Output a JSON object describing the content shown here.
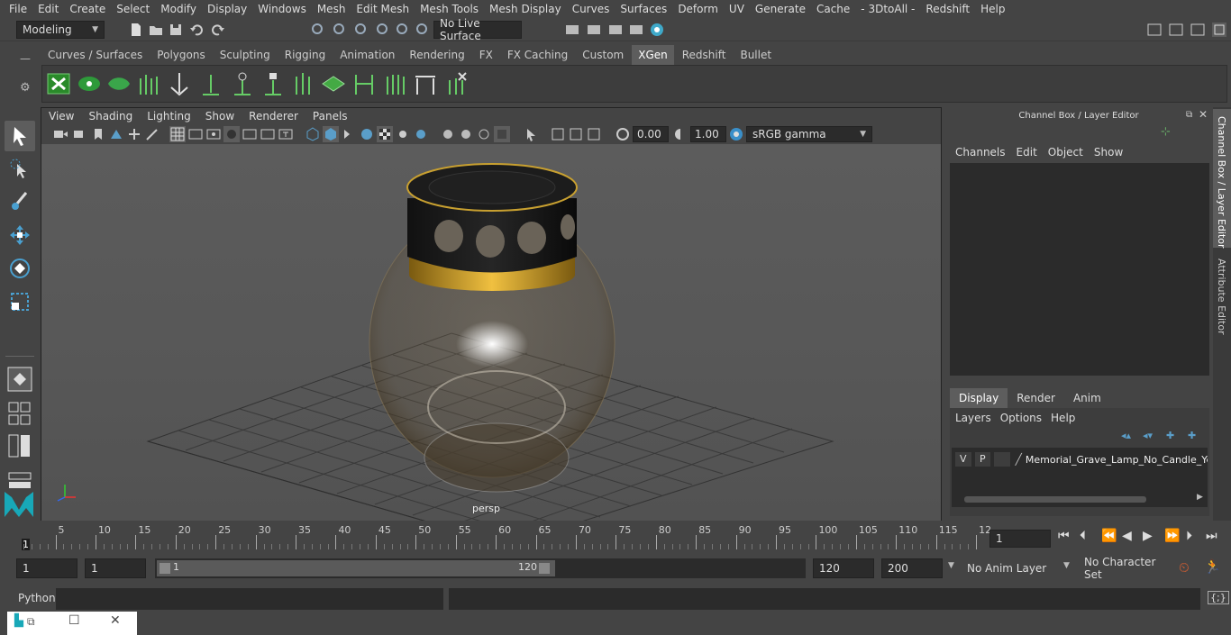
{
  "menu": [
    "File",
    "Edit",
    "Create",
    "Select",
    "Modify",
    "Display",
    "Windows",
    "Mesh",
    "Edit Mesh",
    "Mesh Tools",
    "Mesh Display",
    "Curves",
    "Surfaces",
    "Deform",
    "UV",
    "Generate",
    "Cache",
    "- 3DtoAll -",
    "Redshift",
    "Help"
  ],
  "workspace_mode": "Modeling",
  "live_surface": "No Live Surface",
  "shelf_tabs": [
    "Curves / Surfaces",
    "Polygons",
    "Sculpting",
    "Rigging",
    "Animation",
    "Rendering",
    "FX",
    "FX Caching",
    "Custom",
    "XGen",
    "Redshift",
    "Bullet"
  ],
  "active_shelf_tab": "XGen",
  "viewport_menu": [
    "View",
    "Shading",
    "Lighting",
    "Show",
    "Renderer",
    "Panels"
  ],
  "viewport_fields": {
    "exposure": "0.00",
    "gamma": "1.00",
    "color_space": "sRGB gamma"
  },
  "camera_label": "persp",
  "channel_box": {
    "title": "Channel Box / Layer Editor",
    "menu": [
      "Channels",
      "Edit",
      "Object",
      "Show"
    ],
    "display_tabs": [
      "Display",
      "Render",
      "Anim"
    ],
    "active_display_tab": "Display",
    "layer_menu": [
      "Layers",
      "Options",
      "Help"
    ],
    "layer": {
      "v": "V",
      "p": "P",
      "name": "Memorial_Grave_Lamp_No_Candle_Ye"
    }
  },
  "side_tabs": [
    "Channel Box / Layer Editor",
    "Attribute Editor"
  ],
  "timeline": {
    "ticks": [
      "5",
      "10",
      "15",
      "20",
      "25",
      "30",
      "35",
      "40",
      "45",
      "50",
      "55",
      "60",
      "65",
      "70",
      "75",
      "80",
      "85",
      "90",
      "95",
      "100",
      "105",
      "110",
      "115",
      "12"
    ],
    "start_label": "1",
    "current_frame": "1"
  },
  "range": {
    "start": "1",
    "playback_start": "1",
    "slider_start": "1",
    "slider_end": "120",
    "playback_end": "120",
    "end": "200",
    "anim_layer": "No Anim Layer",
    "character_set": "No Character Set"
  },
  "command_line": {
    "label": "Python"
  },
  "colors": {
    "accent": "#5285a6",
    "active_tab": "#5d5d5d",
    "panel": "#444444",
    "field": "#2b2b2b"
  }
}
